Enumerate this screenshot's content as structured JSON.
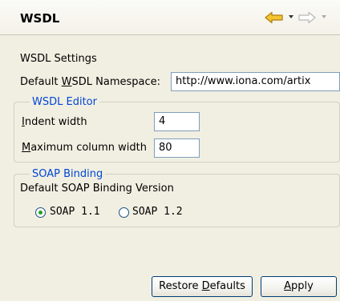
{
  "header": {
    "title": "WSDL"
  },
  "settings": {
    "section_label": "WSDL Settings",
    "namespace_label_pre": "Default ",
    "namespace_label_mnemonic": "W",
    "namespace_label_post": "SDL Namespace:",
    "namespace_value": "http://www.iona.com/artix"
  },
  "wsdl_editor": {
    "title": "WSDL Editor",
    "indent_label_mnemonic": "I",
    "indent_label_post": "ndent width",
    "indent_value": "4",
    "max_col_label_mnemonic": "M",
    "max_col_label_post": "aximum column width",
    "max_col_value": "80"
  },
  "soap_binding": {
    "title": "SOAP Binding",
    "version_label": "Default SOAP Binding Version",
    "options": [
      {
        "label": "SOAP 1.1",
        "selected": true
      },
      {
        "label": "SOAP 1.2",
        "selected": false
      }
    ]
  },
  "buttons": {
    "restore_pre": "Restore ",
    "restore_mnemonic": "D",
    "restore_post": "efaults",
    "apply_mnemonic": "A",
    "apply_post": "pply"
  },
  "icons": {
    "back": "arrow-left-icon",
    "forward": "arrow-right-icon"
  },
  "colors": {
    "background": "#f1efe2",
    "group_title": "#0046d5",
    "back_arrow": "#f3c531",
    "radio_selected": "#21a121"
  }
}
